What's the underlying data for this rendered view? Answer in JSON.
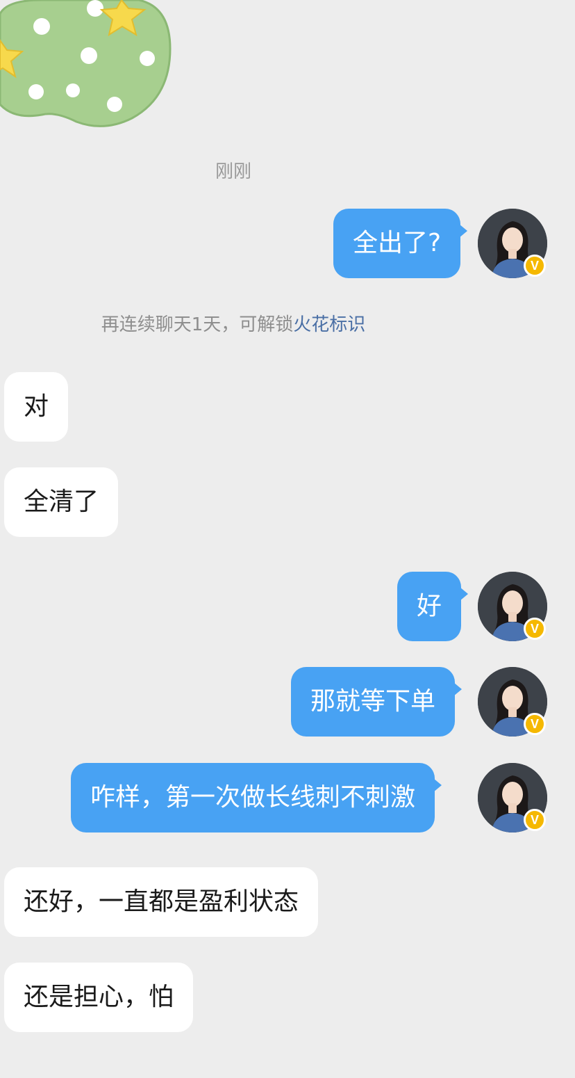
{
  "chat": {
    "timestamp": "刚刚",
    "system_tip": {
      "prefix": "再连续聊天1天，可解锁",
      "link": "火花标识"
    },
    "messages": [
      {
        "dir": "out",
        "text": "全出了?"
      },
      {
        "dir": "in",
        "text": "对"
      },
      {
        "dir": "in",
        "text": "全清了"
      },
      {
        "dir": "out",
        "text": "好"
      },
      {
        "dir": "out",
        "text": "那就等下单"
      },
      {
        "dir": "out",
        "text": "咋样，第一次做长线刺不刺激"
      },
      {
        "dir": "in",
        "text": "还好，一直都是盈利状态"
      },
      {
        "dir": "in",
        "text": "还是担心，怕"
      }
    ],
    "avatar": {
      "badge": "V",
      "badge_color": "#f5b800"
    }
  },
  "colors": {
    "outgoing_bubble": "#48a2f3",
    "incoming_bubble": "#ffffff",
    "background": "#ededed",
    "link": "#4a6fa5"
  }
}
